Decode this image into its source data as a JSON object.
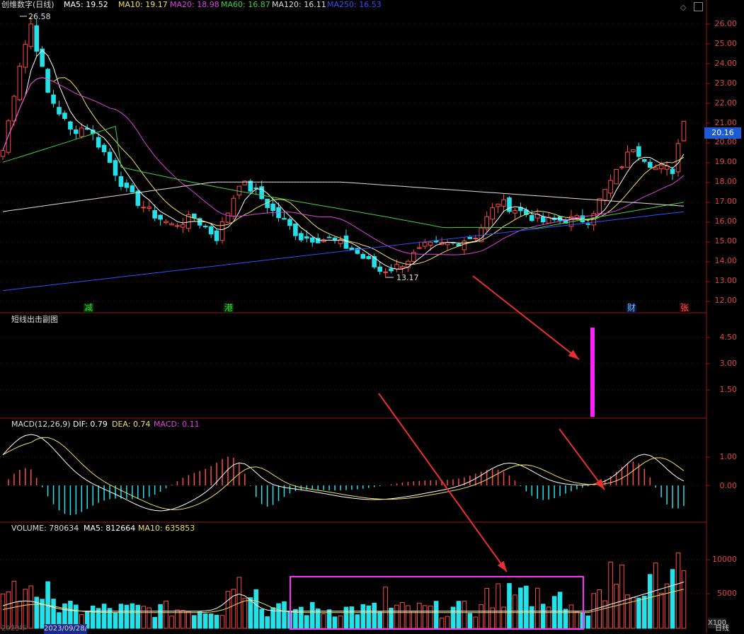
{
  "header": {
    "title": "创维数字(日线)",
    "ma": [
      {
        "label": "MA5: 19.52",
        "color": "#ffffff"
      },
      {
        "label": "MA10: 19.17",
        "color": "#f0e060"
      },
      {
        "label": "MA20: 18.98",
        "color": "#e040e0"
      },
      {
        "label": "MA60: 16.87",
        "color": "#40d040"
      },
      {
        "label": "MA120: 16.11",
        "color": "#dddddd"
      },
      {
        "label": "MA250: 16.53",
        "color": "#3050ff"
      }
    ]
  },
  "price_axis": [
    "26.00",
    "25.00",
    "24.00",
    "23.00",
    "22.00",
    "21.00",
    "20.00",
    "19.00",
    "18.00",
    "17.00",
    "16.00",
    "15.00",
    "14.00",
    "13.00",
    "12.00"
  ],
  "current_price": "20.16",
  "annotations": {
    "high": "26.58",
    "low": "13.17"
  },
  "markers": [
    {
      "text": "减",
      "color": "#40d040",
      "bg": "#003300"
    },
    {
      "text": "港",
      "color": "#40d040",
      "bg": "#003300"
    },
    {
      "text": "财",
      "color": "#80b0ff",
      "bg": "#001a44"
    },
    {
      "text": "张",
      "color": "#ff5050",
      "bg": "#330000"
    }
  ],
  "sub1": {
    "title": "短线出击副图",
    "axis": [
      "4.50",
      "3.00",
      "1.50"
    ]
  },
  "macd": {
    "title": "MACD(12,26,9)",
    "dif": "DIF: 0.79",
    "dea": "DEA: 0.74",
    "macd": "MACD: 0.11",
    "axis": [
      "1.00",
      "0.00"
    ]
  },
  "volume": {
    "title": "VOLUME: 780634",
    "ma5": "MA5: 812664",
    "ma10": "MA10: 635853",
    "axis": [
      "10000",
      "5000"
    ],
    "unit": "X100"
  },
  "bottom": {
    "date": "2023/09/28/",
    "left_date": "2023年",
    "period": "日线"
  },
  "colors": {
    "up": "#ff4a4a",
    "down": "#26e0e8",
    "grid": "#8a1010",
    "ma5": "#ffffff",
    "ma10": "#f0e060",
    "ma20": "#e040e0",
    "ma60": "#40d040",
    "ma120": "#dddddd",
    "ma250": "#3050ff",
    "box": "#ff30ff",
    "arrow": "#e83030"
  }
}
